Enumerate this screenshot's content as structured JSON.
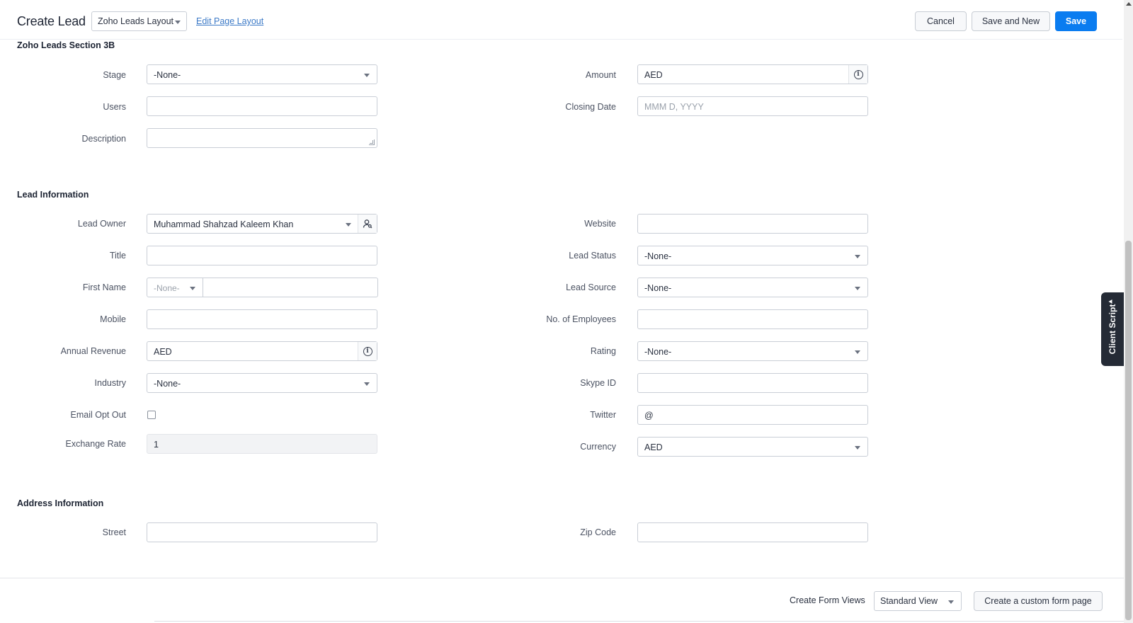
{
  "header": {
    "title": "Create Lead",
    "layout_select": "Zoho Leads Layout",
    "edit_layout_link": "Edit Page Layout",
    "cancel_label": "Cancel",
    "save_new_label": "Save and New",
    "save_label": "Save",
    "colors": {
      "primary_button": "#0a7cf0",
      "link": "#3c7ac7"
    }
  },
  "section_3b": {
    "title": "Zoho Leads Section 3B",
    "stage": {
      "label": "Stage",
      "value": "-None-"
    },
    "users": {
      "label": "Users",
      "value": ""
    },
    "description": {
      "label": "Description",
      "value": ""
    },
    "amount": {
      "label": "Amount",
      "value": "AED"
    },
    "closing_date": {
      "label": "Closing Date",
      "placeholder": "MMM D, YYYY"
    }
  },
  "lead_info": {
    "title": "Lead Information",
    "lead_owner": {
      "label": "Lead Owner",
      "value": "Muhammad Shahzad Kaleem Khan"
    },
    "title_field": {
      "label": "Title",
      "value": ""
    },
    "first_name": {
      "label": "First Name",
      "salutation": "-None-",
      "value": ""
    },
    "mobile": {
      "label": "Mobile",
      "value": ""
    },
    "annual_revenue": {
      "label": "Annual Revenue",
      "value": "AED"
    },
    "industry": {
      "label": "Industry",
      "value": "-None-"
    },
    "email_opt_out": {
      "label": "Email Opt Out",
      "checked": false
    },
    "exchange_rate": {
      "label": "Exchange Rate",
      "value": "1"
    },
    "website": {
      "label": "Website",
      "value": ""
    },
    "lead_status": {
      "label": "Lead Status",
      "value": "-None-"
    },
    "lead_source": {
      "label": "Lead Source",
      "value": "-None-"
    },
    "employees": {
      "label": "No. of Employees",
      "value": ""
    },
    "rating": {
      "label": "Rating",
      "value": "-None-"
    },
    "skype": {
      "label": "Skype ID",
      "value": ""
    },
    "twitter": {
      "label": "Twitter",
      "value": "@"
    },
    "currency": {
      "label": "Currency",
      "value": "AED"
    }
  },
  "address_info": {
    "title": "Address Information",
    "street": {
      "label": "Street",
      "value": ""
    },
    "zip": {
      "label": "Zip Code",
      "value": ""
    }
  },
  "client_script": {
    "label": "Client Script"
  },
  "footer": {
    "form_views_label": "Create Form Views",
    "view_select": "Standard View",
    "custom_page_button": "Create a custom form page"
  }
}
